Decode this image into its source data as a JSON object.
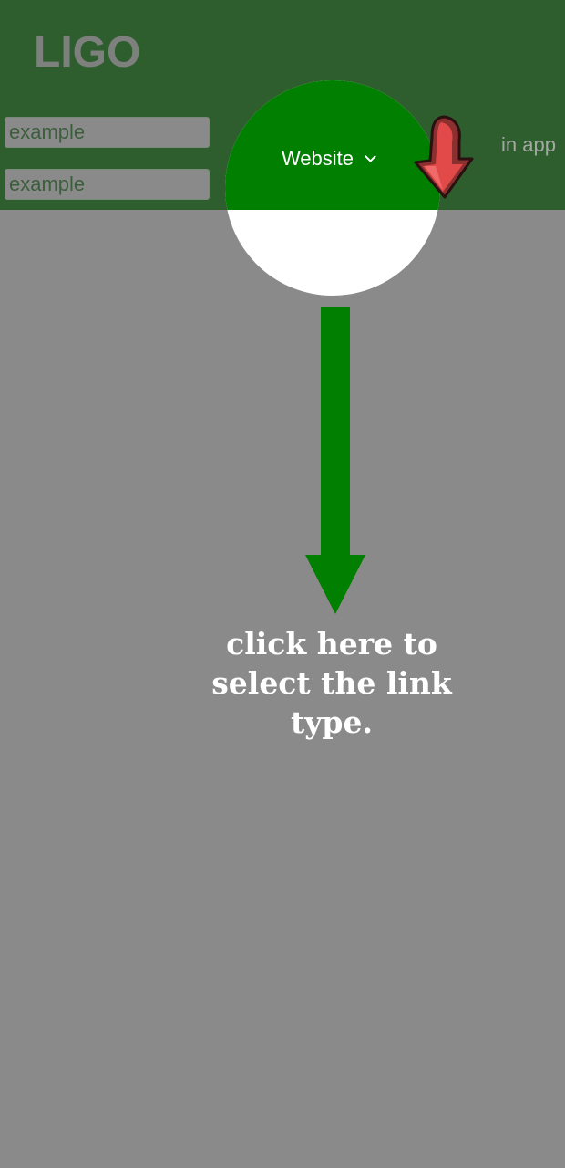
{
  "app": {
    "logo": "LIGO"
  },
  "form": {
    "field_1_value": "example",
    "field_2_value": "example"
  },
  "link_type": {
    "selected": "Website",
    "icon": "chevron-down-icon"
  },
  "mode": {
    "label": "in app"
  },
  "tutorial": {
    "hint": "click here to select the link type.",
    "pointer_icon": "red-down-arrow-icon",
    "guide_icon": "green-down-arrow-icon"
  },
  "colors": {
    "header": "#2e5e2e",
    "overlay": "#8a8a8a",
    "spotlight_green": "#007f00",
    "arrow_green": "#007f00",
    "pointer_red": "#e24a4a"
  }
}
